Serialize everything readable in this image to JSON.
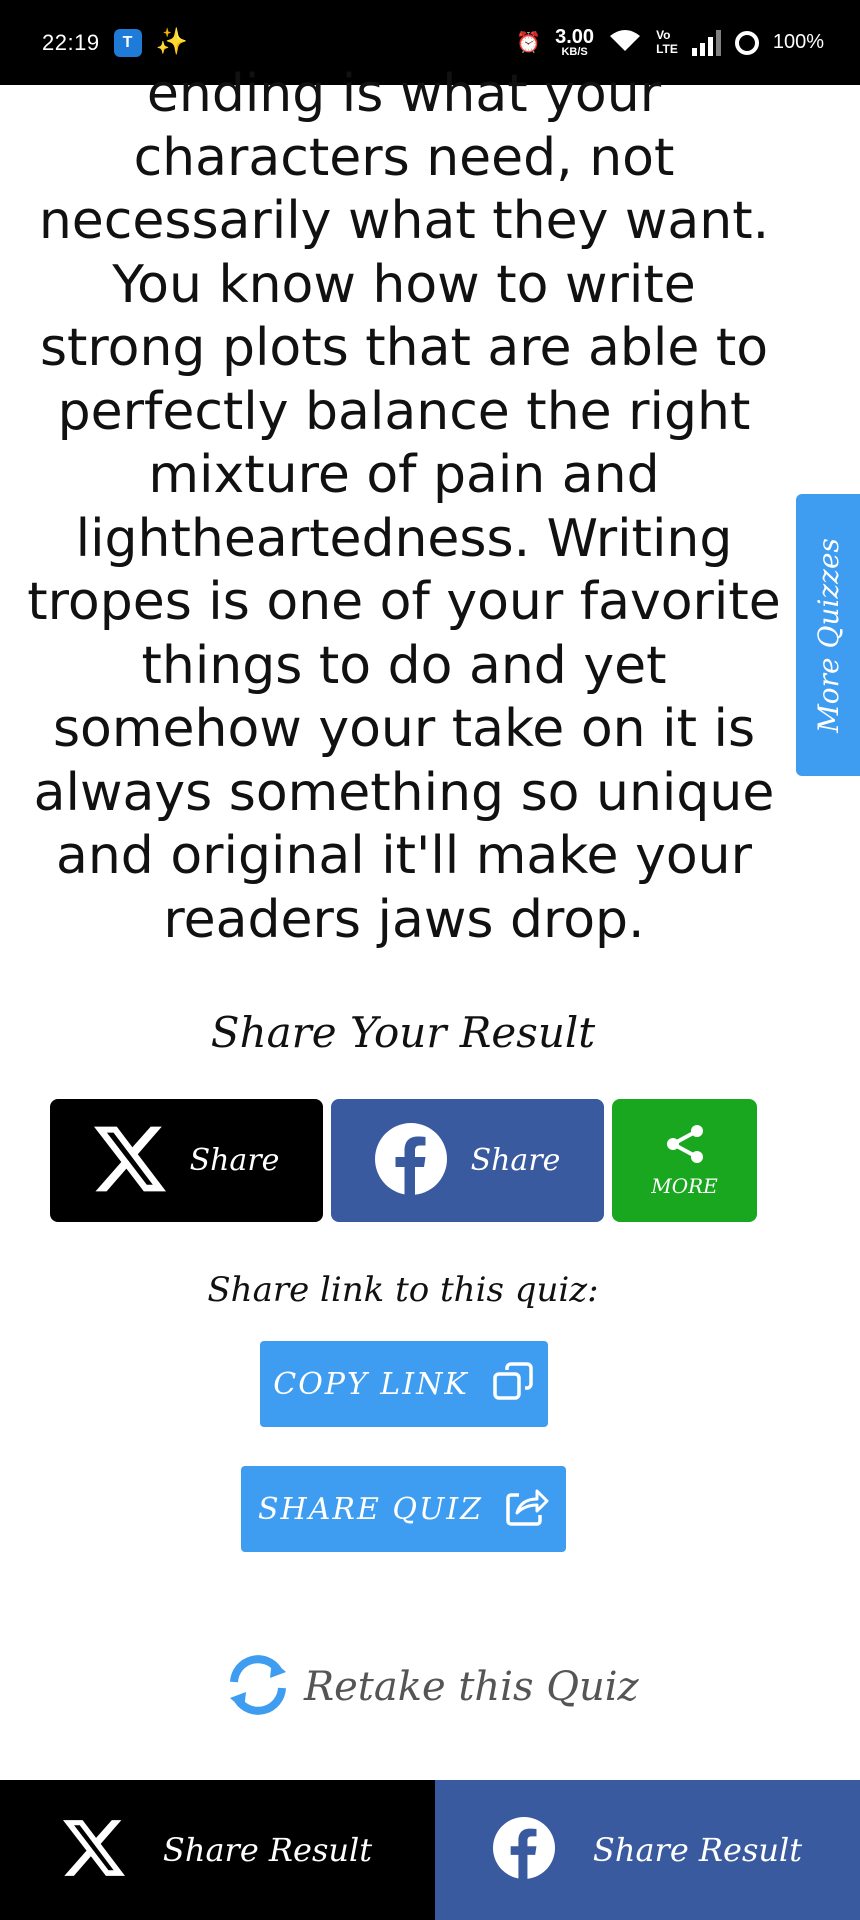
{
  "status_bar": {
    "time": "22:19",
    "app_badge": "T",
    "network_speed_value": "3.00",
    "network_speed_unit": "KB/S",
    "volte_top": "Vo",
    "volte_bottom": "LTE",
    "battery": "100%"
  },
  "result": {
    "text": "ending is what your characters need, not necessarily what they want. You know how to write strong plots that are able to perfectly balance the right mixture of pain and lightheartedness. Writing tropes is one of your favorite things to do and yet somehow your take on it is always something so unique and original it'll make your readers jaws drop."
  },
  "side_tab": {
    "label": "More Quizzes"
  },
  "share": {
    "heading": "Share Your Result",
    "x_label": "Share",
    "facebook_label": "Share",
    "more_label": "MORE"
  },
  "link": {
    "heading": "Share link to this quiz:",
    "copy_label": "COPY LINK",
    "share_quiz_label": "SHARE QUIZ"
  },
  "retake": {
    "label": "Retake this Quiz"
  },
  "bottom_bar": {
    "x_label": "Share Result",
    "facebook_label": "Share Result"
  },
  "colors": {
    "x_black": "#000000",
    "facebook_blue": "#3a5a9f",
    "more_green": "#19a71f",
    "accent_blue": "#3e9df0"
  }
}
